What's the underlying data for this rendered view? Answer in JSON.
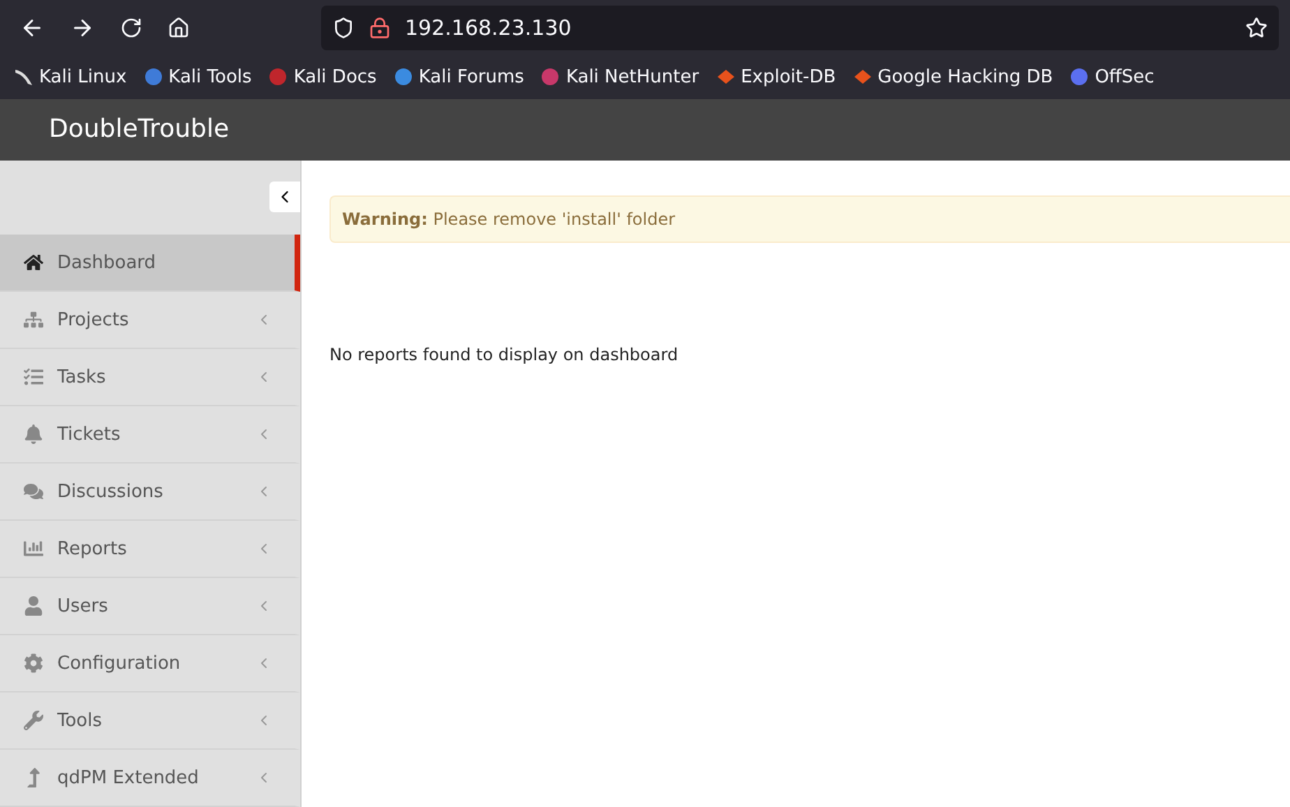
{
  "browser": {
    "url": "192.168.23.130",
    "bookmarks": [
      {
        "label": "Kali Linux",
        "kind": "dragon"
      },
      {
        "label": "Kali Tools",
        "kind": "tools"
      },
      {
        "label": "Kali Docs",
        "kind": "docs"
      },
      {
        "label": "Kali Forums",
        "kind": "forums"
      },
      {
        "label": "Kali NetHunter",
        "kind": "nethunter"
      },
      {
        "label": "Exploit-DB",
        "kind": "bug"
      },
      {
        "label": "Google Hacking DB",
        "kind": "bug"
      },
      {
        "label": "OffSec",
        "kind": "offsec"
      }
    ]
  },
  "app": {
    "title": "DoubleTrouble"
  },
  "sidebar": {
    "items": [
      {
        "label": "Dashboard",
        "kind": "home",
        "selected": true,
        "has_submenu": false
      },
      {
        "label": "Projects",
        "kind": "sitemap",
        "selected": false,
        "has_submenu": true
      },
      {
        "label": "Tasks",
        "kind": "tasks",
        "selected": false,
        "has_submenu": true
      },
      {
        "label": "Tickets",
        "kind": "bell",
        "selected": false,
        "has_submenu": true
      },
      {
        "label": "Discussions",
        "kind": "comments",
        "selected": false,
        "has_submenu": true
      },
      {
        "label": "Reports",
        "kind": "chart",
        "selected": false,
        "has_submenu": true
      },
      {
        "label": "Users",
        "kind": "user",
        "selected": false,
        "has_submenu": true
      },
      {
        "label": "Configuration",
        "kind": "gear",
        "selected": false,
        "has_submenu": true
      },
      {
        "label": "Tools",
        "kind": "wrench",
        "selected": false,
        "has_submenu": true
      },
      {
        "label": "qdPM Extended",
        "kind": "upload",
        "selected": false,
        "has_submenu": true
      }
    ]
  },
  "content": {
    "warning": "**Warning:** Please remove 'install' folder",
    "message": "No reports found to display on dashboard"
  }
}
